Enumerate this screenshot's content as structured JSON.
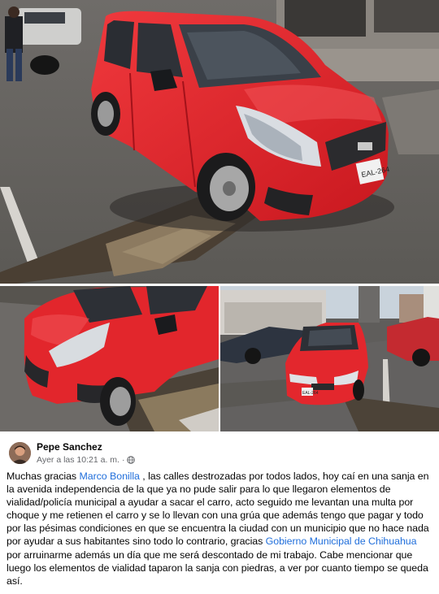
{
  "post": {
    "author": "Pepe Sanchez",
    "timestamp": "Ayer a las 10:21 a. m.",
    "separator": "·",
    "privacy_icon": "globe-icon",
    "text": {
      "part1": "Muchas gracias ",
      "mention1": "Marco Bonilla",
      "part2": " , las calles destrozadas por todos lados, hoy caí en una sanja en la avenida independencia de la que ya no pude salir para lo que llegaron elementos de vialidad/policía municipal a ayudar a sacar el carro, acto seguido me levantan una multa por choque y me retienen el carro y se lo llevan con una grúa que además tengo que pagar y todo por las pésimas condiciones en que se encuentra la ciudad con un municipio que no hace nada por ayudar a sus habitantes sino todo lo contrario, gracias ",
      "mention2": "Gobierno Municipal de Chihuahua",
      "part3": " por arruinarme además un día que me será descontado de mi trabajo. Cabe mencionar que luego los elementos de vialidad taparon la sanja con piedras, a ver por cuanto tiempo se queda así."
    }
  },
  "photos": {
    "main_plate": "EAL-264",
    "right_plate": "EAL-264"
  },
  "colors": {
    "mention": "#216fdb",
    "car_red": "#e0272d",
    "meta": "#65676b"
  }
}
